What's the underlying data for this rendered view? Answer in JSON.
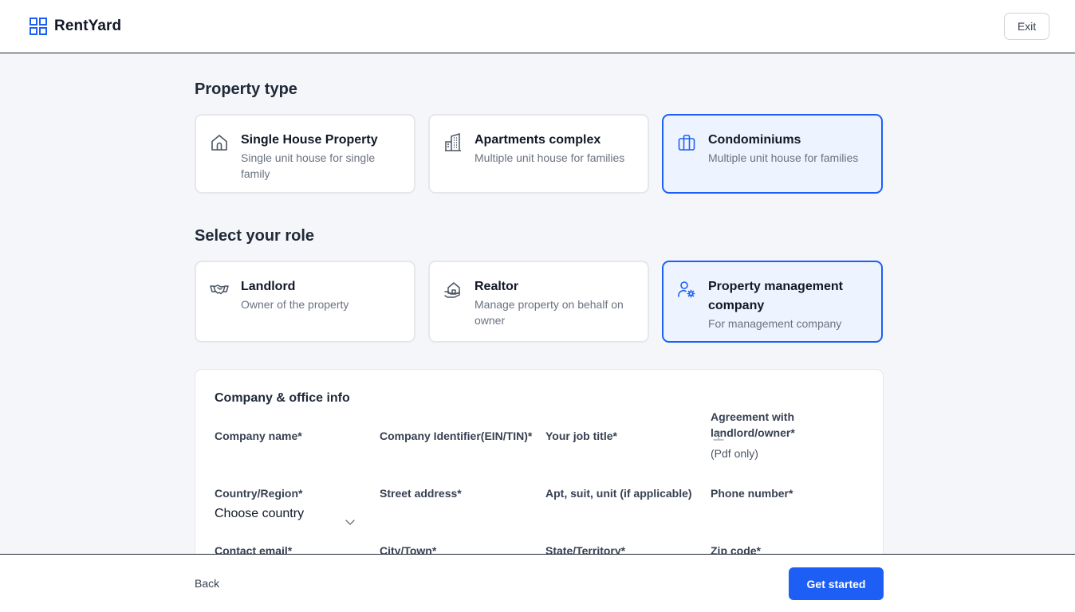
{
  "header": {
    "brand": "RentYard",
    "exit_label": "Exit"
  },
  "property_type": {
    "title": "Property type",
    "options": [
      {
        "title": "Single House Property",
        "desc": "Single unit house for single family",
        "icon": "house-icon",
        "selected": false
      },
      {
        "title": "Apartments complex",
        "desc": "Multiple unit house for families",
        "icon": "apartment-building-icon",
        "selected": false
      },
      {
        "title": "Condominiums",
        "desc": "Multiple unit house for families",
        "icon": "briefcase-icon",
        "selected": true
      }
    ]
  },
  "role": {
    "title": "Select your role",
    "options": [
      {
        "title": "Landlord",
        "desc": "Owner of the property",
        "icon": "handshake-icon",
        "selected": false
      },
      {
        "title": "Realtor",
        "desc": "Manage property on behalf on owner",
        "icon": "house-hand-icon",
        "selected": false
      },
      {
        "title": "Property management company",
        "desc": "For management company",
        "icon": "user-gear-icon",
        "selected": true
      }
    ]
  },
  "company_form": {
    "title": "Company & office info",
    "fields": {
      "company_name": "Company name*",
      "company_identifier": "Company Identifier(EIN/TIN)*",
      "job_title": "Your job title*",
      "agreement": "Agreement with landlord/owner*",
      "agreement_hint": "(Pdf only)",
      "country": "Country/Region*",
      "country_value": "Choose country",
      "street": "Street address*",
      "apt": "Apt, suit, unit (if applicable)",
      "phone": "Phone number*",
      "email": "Contact email*",
      "city": "City/Town*",
      "state": "State/Territory*",
      "zip": "Zip code*"
    }
  },
  "footer": {
    "back_label": "Back",
    "cta_label": "Get started"
  },
  "colors": {
    "accent": "#1d5ff5",
    "selected_bg": "#eef4ff"
  }
}
